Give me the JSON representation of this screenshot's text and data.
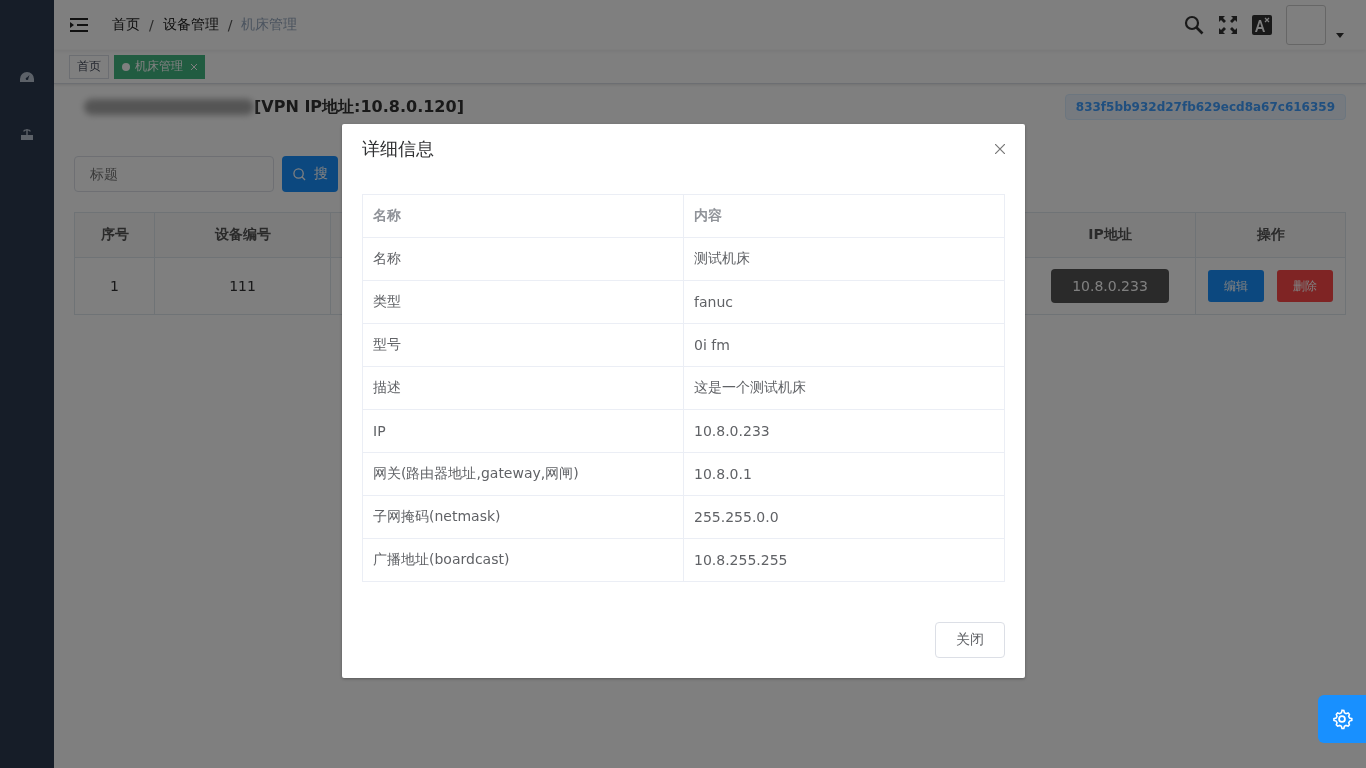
{
  "breadcrumb": [
    "首页",
    "设备管理",
    "机床管理"
  ],
  "breadcrumb_separators": [
    "/",
    "/"
  ],
  "tags": [
    {
      "label": "首页",
      "selected": false
    },
    {
      "label": "机床管理",
      "selected": true
    }
  ],
  "page_title": "[VPN IP地址:10.8.0.120]",
  "device_id_badge": "833f5bb932d27fb629ecd8a67c616359",
  "search": {
    "placeholder": "标题",
    "button": "搜"
  },
  "table": {
    "columns": [
      "序号",
      "设备编号",
      "IP地址",
      "操作"
    ],
    "rows": [
      {
        "index": "1",
        "device_no": "111",
        "ip": "10.8.0.233",
        "actions": [
          {
            "label": "编辑",
            "kind": "primary"
          },
          {
            "label": "删除",
            "kind": "danger"
          }
        ]
      }
    ]
  },
  "dialog": {
    "title": "详细信息",
    "columns": [
      "名称",
      "内容"
    ],
    "rows": [
      [
        "名称",
        "测试机床"
      ],
      [
        "类型",
        "fanuc"
      ],
      [
        "型号",
        "0i fm"
      ],
      [
        "描述",
        "这是一个测试机床"
      ],
      [
        "IP",
        "10.8.0.233"
      ],
      [
        "网关(路由器地址,gateway,网闸)",
        "10.8.0.1"
      ],
      [
        "子网掩码(netmask)",
        "255.255.0.0"
      ],
      [
        "广播地址(boardcast)",
        "10.8.255.255"
      ]
    ],
    "close_button": "关闭"
  }
}
